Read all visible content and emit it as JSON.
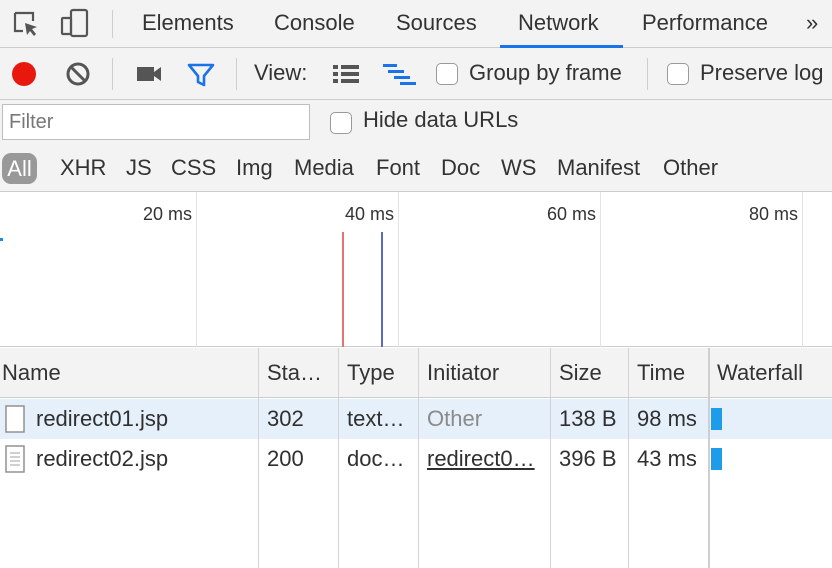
{
  "tabs": {
    "items": [
      "Elements",
      "Console",
      "Sources",
      "Network",
      "Performance"
    ],
    "active": "Network",
    "more": "»"
  },
  "toolbar": {
    "view_label": "View:",
    "group_by_frame": "Group by frame",
    "preserve_log": "Preserve log"
  },
  "filter": {
    "placeholder": "Filter",
    "hide_data_urls": "Hide data URLs"
  },
  "types": [
    "All",
    "XHR",
    "JS",
    "CSS",
    "Img",
    "Media",
    "Font",
    "Doc",
    "WS",
    "Manifest",
    "Other"
  ],
  "overview": {
    "ticks": [
      "20 ms",
      "40 ms",
      "60 ms",
      "80 ms"
    ]
  },
  "table": {
    "columns": [
      "Name",
      "Sta…",
      "Type",
      "Initiator",
      "Size",
      "Time",
      "Waterfall"
    ],
    "rows": [
      {
        "name": "redirect01.jsp",
        "status": "302",
        "type": "text…",
        "initiator": "Other",
        "size": "138 B",
        "time": "98 ms"
      },
      {
        "name": "redirect02.jsp",
        "status": "200",
        "type": "doc…",
        "initiator": "redirect0…",
        "size": "396 B",
        "time": "43 ms"
      }
    ]
  },
  "colors": {
    "record": "#e8180f",
    "accent": "#1a73e8",
    "waterfall_bar": "#1e9be9",
    "selected_row": "#e6f0fb"
  }
}
